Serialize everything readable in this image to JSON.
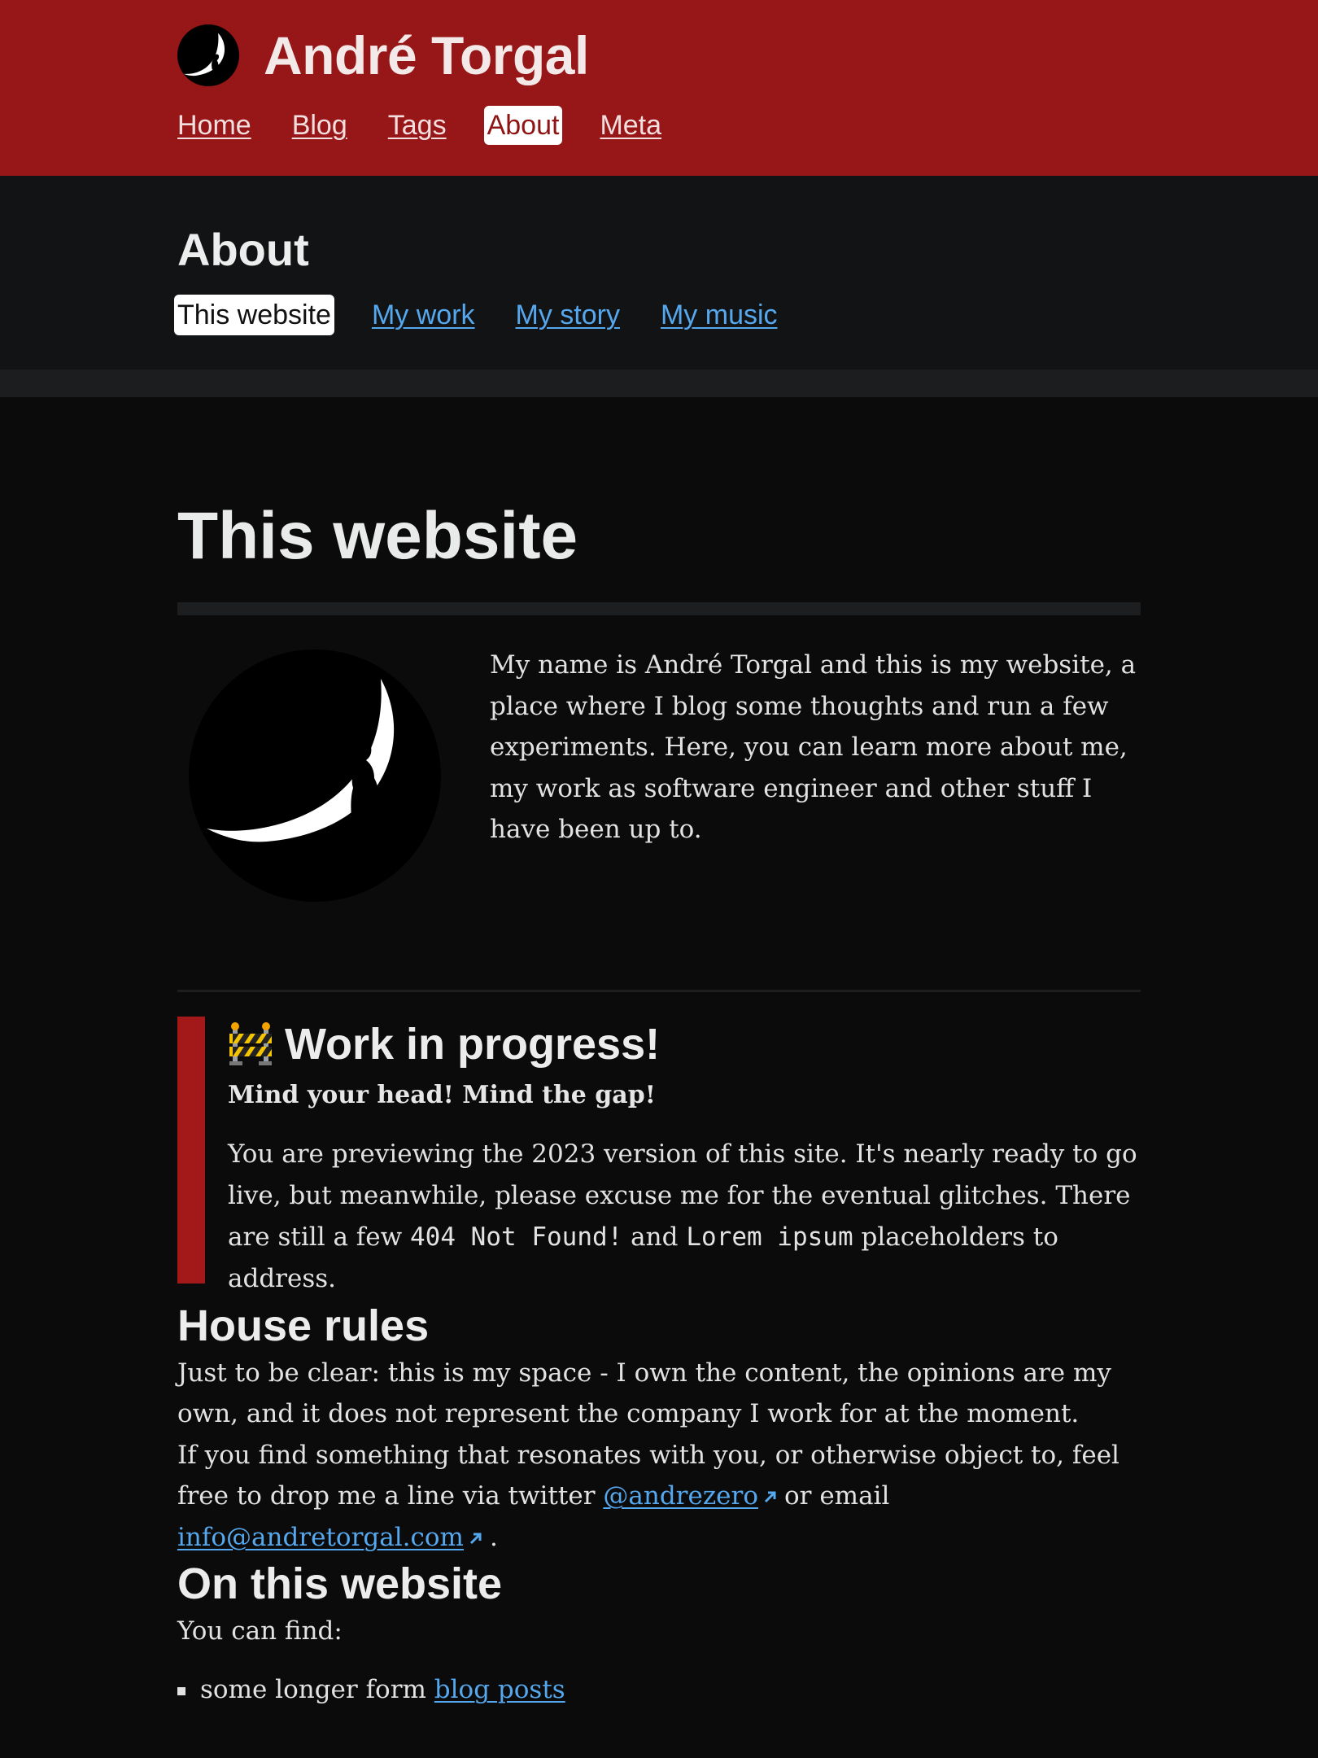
{
  "header": {
    "site_name": "André Torgal",
    "nav": [
      {
        "label": "Home"
      },
      {
        "label": "Blog"
      },
      {
        "label": "Tags"
      },
      {
        "label": "About",
        "active": true
      },
      {
        "label": "Meta"
      }
    ]
  },
  "subheader": {
    "title": "About",
    "tabs": [
      {
        "label": "This website",
        "active": true
      },
      {
        "label": "My work"
      },
      {
        "label": "My story"
      },
      {
        "label": "My music"
      }
    ]
  },
  "page": {
    "title": "This website",
    "intro": "My name is André Torgal and this is my website, a place where I blog some thoughts and run a few experiments. Here, you can learn more about me, my work as software engineer and other stuff I have been up to.",
    "callout": {
      "icon": "construction-barrier-icon",
      "title": "Work in progress!",
      "subtitle": "Mind your head! Mind the gap!",
      "text_before": "You are previewing the 2023 version of this site. It's nearly ready to go live, but meanwhile, please excuse me for the eventual glitches. There are still a few",
      "code1": "404 Not Found!",
      "text_mid": "and",
      "code2": "Lorem ipsum",
      "text_after": "placeholders to address."
    },
    "house_rules": {
      "title": "House rules",
      "p1": "Just to be clear: this is my space - I own the content, the opinions are my own, and it does not represent the company I work for at the moment.",
      "p2_before": "If you find something that resonates with you, or otherwise object to, feel free to drop me a line via twitter",
      "twitter_link": "@andrezero",
      "p2_mid": "or email",
      "email_link": "info@andretorgal.com",
      "p2_after": "."
    },
    "on_this_website": {
      "title": "On this website",
      "intro": "You can find:",
      "items": [
        {
          "before": "some longer form",
          "link": "blog posts"
        }
      ]
    }
  },
  "colors": {
    "header_bg": "#971617",
    "accent_red": "#a3191a",
    "link_blue": "#56a8ee",
    "page_bg": "#0b0b0c"
  }
}
